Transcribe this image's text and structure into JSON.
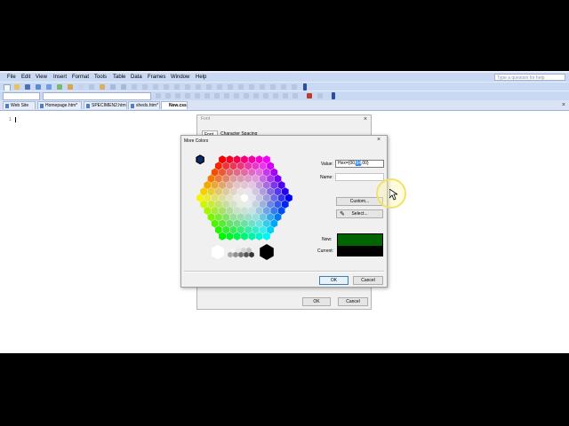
{
  "menubar": {
    "items": [
      "File",
      "Edit",
      "View",
      "Insert",
      "Format",
      "Tools",
      "Table",
      "Data",
      "Frames",
      "Window",
      "Help"
    ],
    "help_placeholder": "Type a question for help"
  },
  "tabs": {
    "items": [
      {
        "label": "Web Site",
        "active": false
      },
      {
        "label": "Homepage.htm*",
        "active": false
      },
      {
        "label": "SPECIMEN2.htm",
        "active": false
      },
      {
        "label": "sheds.htm*",
        "active": false
      },
      {
        "label": "New.css",
        "active": true
      }
    ],
    "close_glyph": "×"
  },
  "editor": {
    "line_number": "1"
  },
  "font_dialog": {
    "title": "Font",
    "tabs": [
      "Font",
      "Character Spacing"
    ],
    "ok_label": "OK",
    "cancel_label": "Cancel"
  },
  "more_colors": {
    "title": "More Colors",
    "value_label": "Value:",
    "value_prefix": "Hex={00,",
    "value_selected": "64",
    "value_suffix": ",00}",
    "name_label": "Name:",
    "custom_label": "Custom...",
    "select_label": "Select...",
    "new_label": "New:",
    "current_label": "Current:",
    "ok_label": "OK",
    "cancel_label": "Cancel",
    "new_color": "#006400",
    "current_color": "#000000",
    "grayscale": [
      "#ffffff",
      "#f5f5f5",
      "#e8e8e8",
      "#d6d6d6",
      "#c2c2c2",
      "#aaaaaa",
      "#8f8f8f",
      "#737373",
      "#555555",
      "#333333",
      "#000000"
    ]
  }
}
